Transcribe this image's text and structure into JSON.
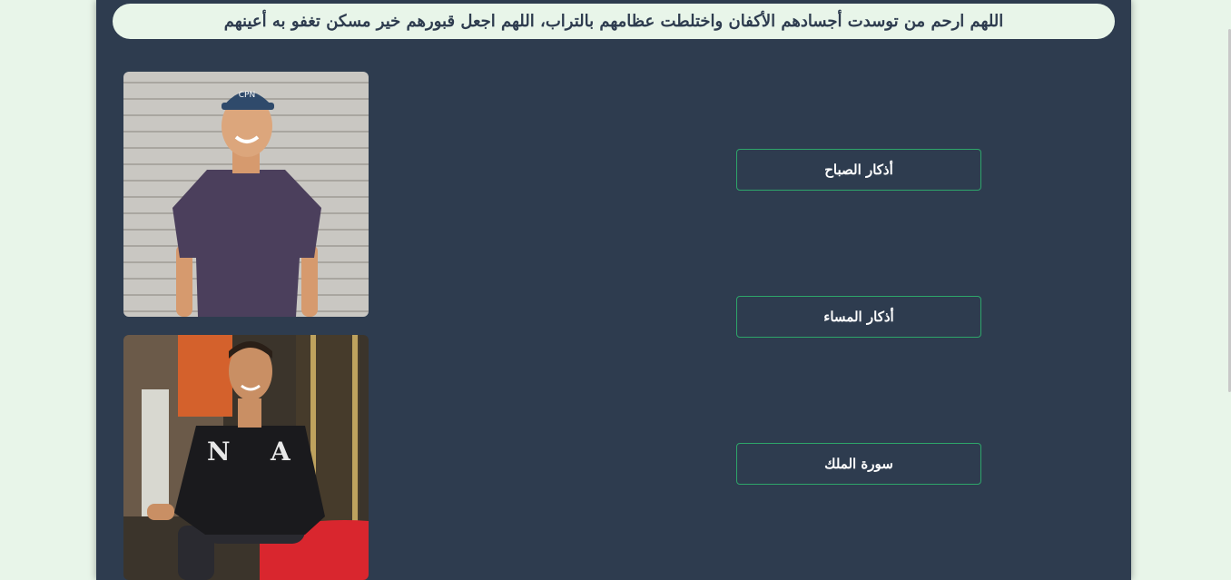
{
  "banner": {
    "text": "اللهم ارحم من توسدت أجسادهم الأكفان واختلطت عظامهم بالتراب، اللهم اجعل قبورهم خير مسكن تغفو به أعينهم"
  },
  "photos": [
    {
      "name": "portrait-photo-1"
    },
    {
      "name": "portrait-photo-2"
    }
  ],
  "buttons": {
    "morning_adhkar": "أذكار الصباح",
    "evening_adhkar": "أذكار المساء",
    "surah_al_mulk": "سورة الملك"
  },
  "colors": {
    "page_background": "#e8f5e9",
    "panel_background": "#2e3c4f",
    "button_border": "#2ea56a",
    "button_text": "#ffffff"
  }
}
